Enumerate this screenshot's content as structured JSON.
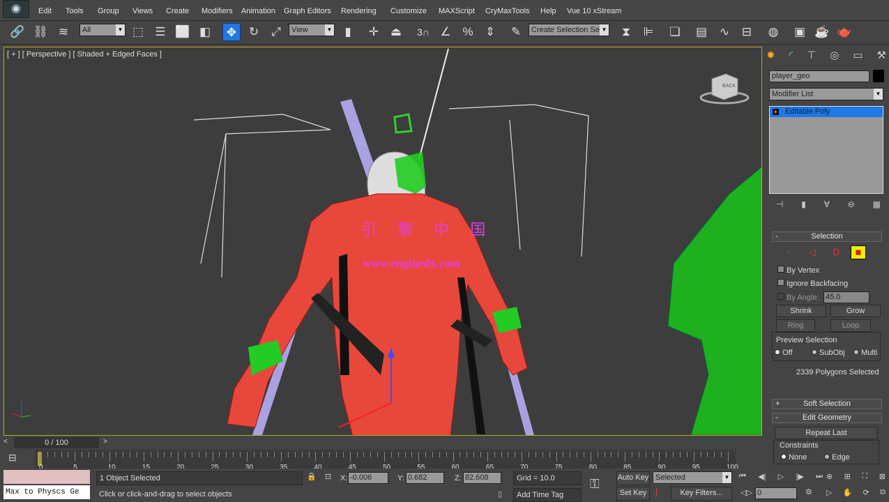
{
  "menu": [
    "Edit",
    "Tools",
    "Group",
    "Views",
    "Create",
    "Modifiers",
    "Animation",
    "Graph Editors",
    "Rendering",
    "Customize",
    "MAXScript",
    "CryMaxTools",
    "Help",
    "Vue 10 xStream"
  ],
  "toolbar": {
    "selection_filter": "All",
    "ref_coord": "View",
    "named_selection": "Create Selection Se",
    "snap_number": "3"
  },
  "viewport": {
    "label": "[ + ] [ Perspective ] [ Shaded + Edged Faces ]",
    "watermark_cn": "引 擎 中 国",
    "watermark_url": "www.enginedx.com",
    "viewcube": "BACK"
  },
  "panel": {
    "object_name": "player_geo",
    "object_color": "#000000",
    "modifier_list": "Modifier List",
    "stack_item": "Editable Poly",
    "selection": {
      "title": "Selection",
      "by_vertex": "By Vertex",
      "ignore_backfacing": "Ignore Backfacing",
      "by_angle": "By Angle:",
      "angle_value": "45.0",
      "shrink": "Shrink",
      "grow": "Grow",
      "ring": "Ring",
      "loop": "Loop",
      "preview": "Preview Selection",
      "off": "Off",
      "subobj": "SubObj",
      "multi": "Multi",
      "count": "2339 Polygons Selected"
    },
    "soft_selection": "Soft Selection",
    "edit_geometry": "Edit Geometry",
    "repeat_last": "Repeat Last",
    "constraints": "Constraints",
    "none": "None",
    "edge": "Edge"
  },
  "timeline": {
    "frame": "0 / 100",
    "ticks": [
      "0",
      "5",
      "10",
      "15",
      "20",
      "25",
      "30",
      "35",
      "40",
      "45",
      "50",
      "55",
      "60",
      "65",
      "70",
      "75",
      "80",
      "85",
      "90",
      "95",
      "100"
    ]
  },
  "status": {
    "script_listener": "Max to Physcs Ge",
    "selected": "1 Object Selected",
    "prompt": "Click or click-and-drag to select objects",
    "x_label": "X:",
    "x": "-0.006",
    "y_label": "Y:",
    "y": "0.682",
    "z_label": "Z:",
    "z": "82.608",
    "grid": "Grid = 10.0",
    "add_time_tag": "Add Time Tag",
    "auto_key": "Auto Key",
    "set_key": "Set Key",
    "key_mode": "Selected",
    "key_filters": "Key Filters...",
    "current_frame": "0"
  },
  "colors": {
    "accent": "#1e78e6",
    "selected_mesh": "#e8483c",
    "viewport_border": "#c8a020"
  }
}
